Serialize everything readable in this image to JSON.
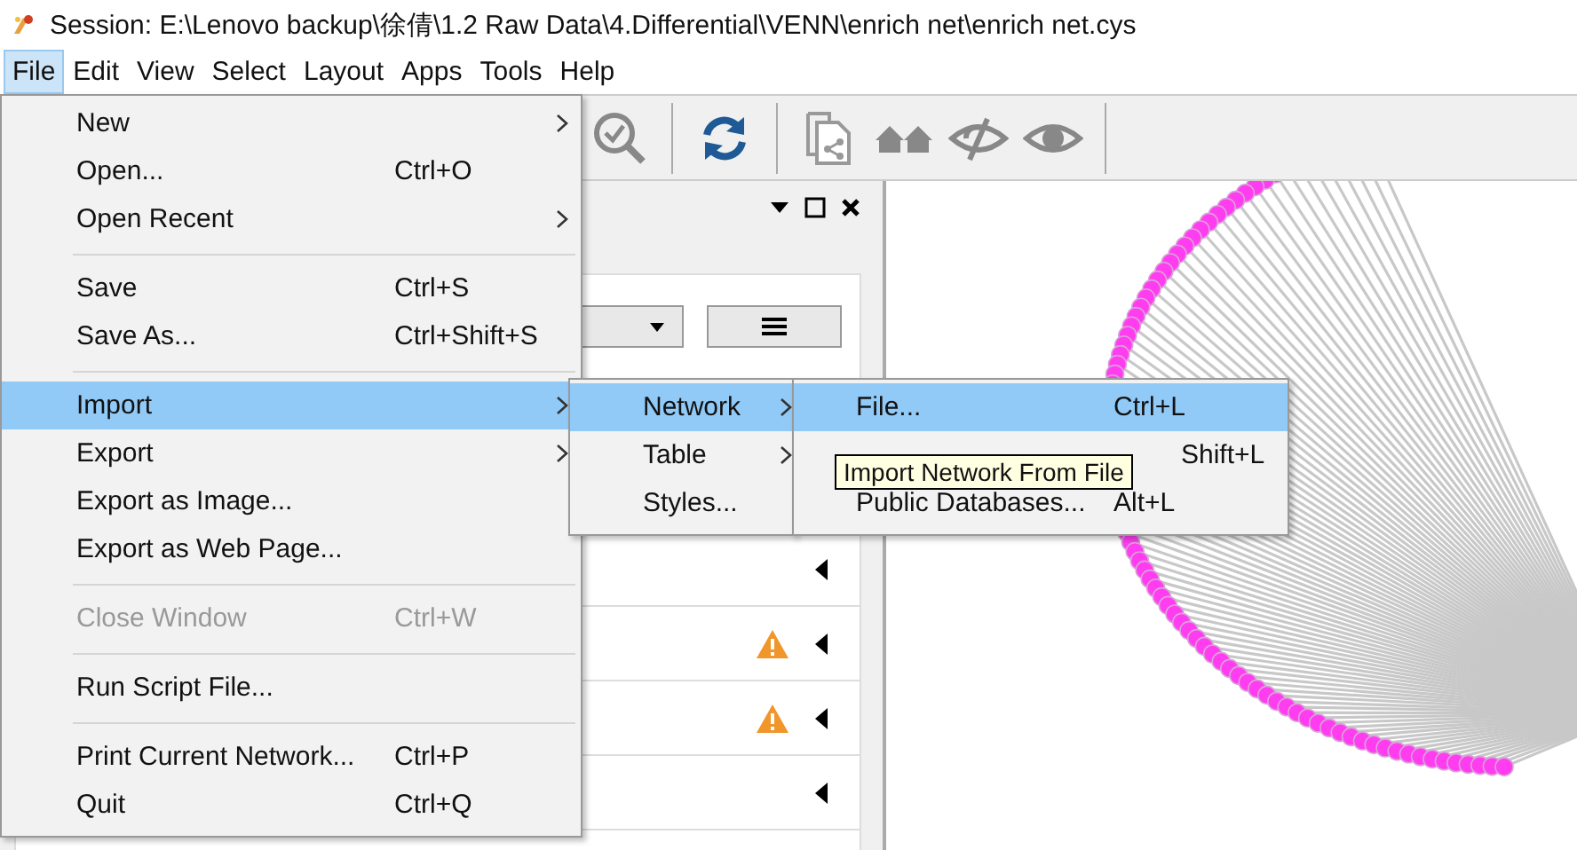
{
  "window": {
    "title": "Session: E:\\Lenovo backup\\徐倩\\1.2 Raw Data\\4.Differential\\VENN\\enrich net\\enrich net.cys"
  },
  "menubar": [
    {
      "label": "File",
      "selected": true
    },
    {
      "label": "Edit",
      "selected": false
    },
    {
      "label": "View",
      "selected": false
    },
    {
      "label": "Select",
      "selected": false
    },
    {
      "label": "Layout",
      "selected": false
    },
    {
      "label": "Apps",
      "selected": false
    },
    {
      "label": "Tools",
      "selected": false
    },
    {
      "label": "Help",
      "selected": false
    }
  ],
  "file_menu": [
    {
      "kind": "item",
      "label": "New",
      "submenu": true,
      "selected": false,
      "disabled": false
    },
    {
      "kind": "item",
      "label": "Open...",
      "shortcut": "Ctrl+O",
      "submenu": false,
      "selected": false,
      "disabled": false
    },
    {
      "kind": "item",
      "label": "Open Recent",
      "submenu": true,
      "selected": false,
      "disabled": false
    },
    {
      "kind": "separator"
    },
    {
      "kind": "item",
      "label": "Save",
      "shortcut": "Ctrl+S",
      "submenu": false,
      "selected": false,
      "disabled": false
    },
    {
      "kind": "item",
      "label": "Save As...",
      "shortcut": "Ctrl+Shift+S",
      "submenu": false,
      "selected": false,
      "disabled": false
    },
    {
      "kind": "separator"
    },
    {
      "kind": "item",
      "label": "Import",
      "submenu": true,
      "selected": true,
      "disabled": false
    },
    {
      "kind": "item",
      "label": "Export",
      "submenu": true,
      "selected": false,
      "disabled": false
    },
    {
      "kind": "item",
      "label": "Export as Image...",
      "submenu": false,
      "selected": false,
      "disabled": false
    },
    {
      "kind": "item",
      "label": "Export as Web Page...",
      "submenu": false,
      "selected": false,
      "disabled": false
    },
    {
      "kind": "separator"
    },
    {
      "kind": "item",
      "label": "Close Window",
      "shortcut": "Ctrl+W",
      "submenu": false,
      "selected": false,
      "disabled": true
    },
    {
      "kind": "separator"
    },
    {
      "kind": "item",
      "label": "Run Script File...",
      "submenu": false,
      "selected": false,
      "disabled": false
    },
    {
      "kind": "separator"
    },
    {
      "kind": "item",
      "label": "Print Current Network...",
      "shortcut": "Ctrl+P",
      "submenu": false,
      "selected": false,
      "disabled": false
    },
    {
      "kind": "item",
      "label": "Quit",
      "shortcut": "Ctrl+Q",
      "submenu": false,
      "selected": false,
      "disabled": false
    }
  ],
  "import_menu": [
    {
      "label": "Network",
      "submenu": true,
      "selected": true
    },
    {
      "label": "Table",
      "submenu": true,
      "selected": false
    },
    {
      "label": "Styles...",
      "submenu": false,
      "selected": false
    }
  ],
  "network_menu": [
    {
      "kind": "item",
      "label": "File...",
      "shortcut": "Ctrl+L",
      "selected": true
    },
    {
      "kind": "covered",
      "shortcut": "Shift+L",
      "selected": false
    },
    {
      "kind": "item",
      "label": "Public Databases...",
      "shortcut": "Alt+L",
      "selected": false
    }
  ],
  "tooltip": "Import Network From File",
  "panel_rows": [
    {
      "warning": false
    },
    {
      "warning": true
    },
    {
      "warning": true
    },
    {
      "warning": false
    }
  ]
}
